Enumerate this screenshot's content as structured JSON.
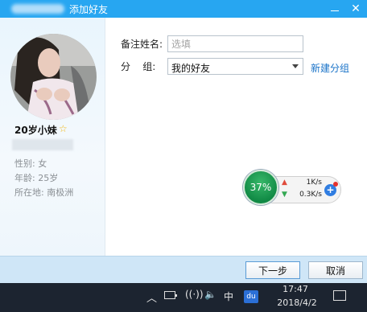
{
  "window": {
    "title": "添加好友"
  },
  "profile": {
    "nickname": "20岁小妹",
    "gender": "性别: 女",
    "age": "年龄: 25岁",
    "location": "所在地: 南极洲"
  },
  "form": {
    "remark_label": "备注姓名:",
    "remark_placeholder": "选填",
    "group_label": "分    组:",
    "group_value": "我的好友",
    "new_group_link": "新建分组"
  },
  "speed_widget": {
    "percent": "37%",
    "upload": "1K/s",
    "download": "0.3K/s"
  },
  "buttons": {
    "next": "下一步",
    "cancel": "取消"
  },
  "taskbar": {
    "ime": "中",
    "du": "du",
    "time": "17:47",
    "date": "2018/4/2"
  },
  "colors": {
    "titlebar": "#27a6f1",
    "link": "#1a73c8",
    "footer": "#cfe6f7",
    "speed_green": "#118a45"
  },
  "icons": [
    "close-icon",
    "minimize-icon",
    "star-icon",
    "dropdown-icon",
    "up-arrow-icon",
    "down-arrow-icon",
    "boost-icon",
    "chevron-up-icon",
    "battery-icon",
    "wifi-icon",
    "volume-icon",
    "notification-icon"
  ]
}
